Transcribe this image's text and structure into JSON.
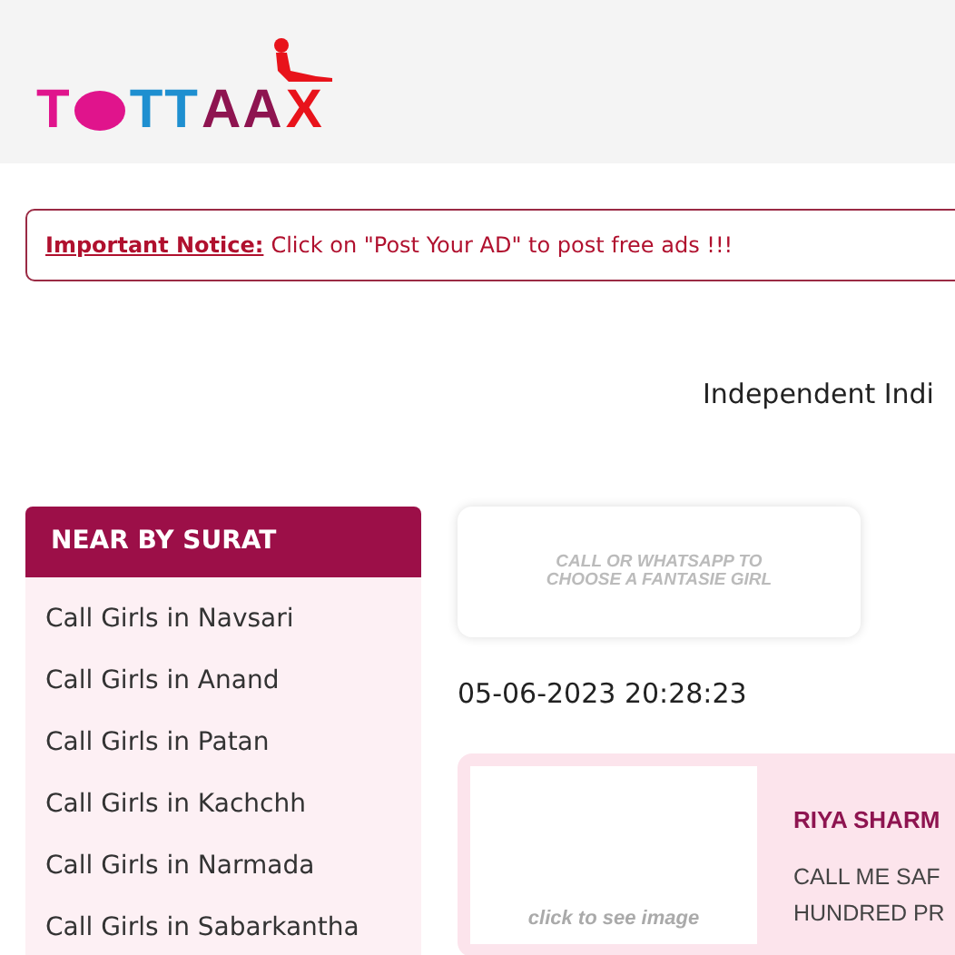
{
  "logo": {
    "letters": [
      {
        "text": "T",
        "color": "#e0148c"
      },
      {
        "kind": "lips",
        "color": "#e0148c"
      },
      {
        "text": "TT",
        "color": "#1e8fd0"
      },
      {
        "text": "AA",
        "color": "#8e1450"
      },
      {
        "text": "X",
        "color": "#e8131b"
      }
    ]
  },
  "notice": {
    "label": "Important Notice:",
    "text": "Click on \"Post Your AD\" to post free ads !!!"
  },
  "heading": "Independent Indi",
  "sidebar": {
    "title": "NEAR BY SURAT",
    "items": [
      "Call Girls in Navsari",
      "Call Girls in Anand",
      "Call Girls in Patan",
      "Call Girls in Kachchh",
      "Call Girls in Narmada",
      "Call Girls in Sabarkantha"
    ]
  },
  "banner": {
    "line1": "CALL OR WHATSAPP TO",
    "line2": "CHOOSE A FANTASIE GIRL"
  },
  "timestamp": "05-06-2023 20:28:23",
  "listing": {
    "image_hint": "click to see image",
    "name": "RIYA SHARM",
    "desc": [
      "CALL ME SAF",
      "HUNDRED PR"
    ]
  }
}
